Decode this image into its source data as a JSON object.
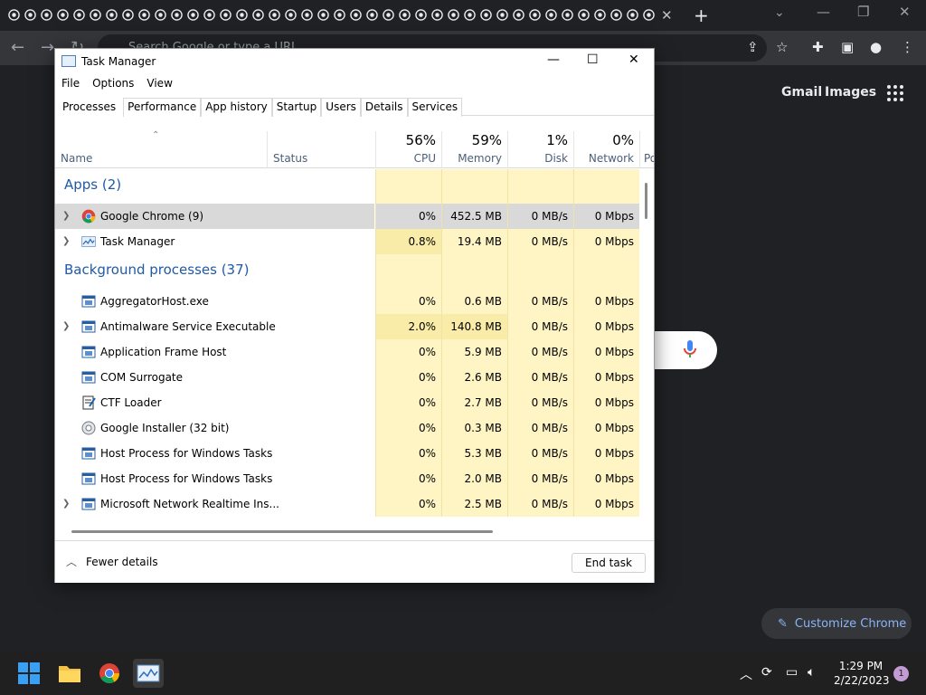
{
  "browser": {
    "omnibox_placeholder": "Search Google or type a URL",
    "tab_close": "✕",
    "new_tab": "+",
    "links": {
      "gmail": "Gmail",
      "images": "Images"
    },
    "customize": "Customize Chrome"
  },
  "taskmanager": {
    "title": "Task Manager",
    "menu": [
      "File",
      "Options",
      "View"
    ],
    "tabs": [
      "Processes",
      "Performance",
      "App history",
      "Startup",
      "Users",
      "Details",
      "Services"
    ],
    "columns": {
      "name": "Name",
      "status": "Status",
      "cpu": {
        "pct": "56%",
        "label": "CPU"
      },
      "memory": {
        "pct": "59%",
        "label": "Memory"
      },
      "disk": {
        "pct": "1%",
        "label": "Disk"
      },
      "network": {
        "pct": "0%",
        "label": "Network"
      },
      "power": "Po"
    },
    "apps_group": "Apps (2)",
    "bg_group": "Background processes (37)",
    "apps": [
      {
        "name": "Google Chrome (9)",
        "cpu": "0%",
        "mem": "452.5 MB",
        "disk": "0 MB/s",
        "net": "0 Mbps",
        "icon": "chrome-icon",
        "expand": true
      },
      {
        "name": "Task Manager",
        "cpu": "0.8%",
        "mem": "19.4 MB",
        "disk": "0 MB/s",
        "net": "0 Mbps",
        "icon": "task-manager-icon",
        "expand": true
      }
    ],
    "background": [
      {
        "name": "AggregatorHost.exe",
        "cpu": "0%",
        "mem": "0.6 MB",
        "disk": "0 MB/s",
        "net": "0 Mbps",
        "icon": "window-icon",
        "expand": false
      },
      {
        "name": "Antimalware Service Executable",
        "cpu": "2.0%",
        "mem": "140.8 MB",
        "disk": "0 MB/s",
        "net": "0 Mbps",
        "icon": "window-icon",
        "expand": true
      },
      {
        "name": "Application Frame Host",
        "cpu": "0%",
        "mem": "5.9 MB",
        "disk": "0 MB/s",
        "net": "0 Mbps",
        "icon": "window-icon",
        "expand": false
      },
      {
        "name": "COM Surrogate",
        "cpu": "0%",
        "mem": "2.6 MB",
        "disk": "0 MB/s",
        "net": "0 Mbps",
        "icon": "window-icon",
        "expand": false
      },
      {
        "name": "CTF Loader",
        "cpu": "0%",
        "mem": "2.7 MB",
        "disk": "0 MB/s",
        "net": "0 Mbps",
        "icon": "notepad-icon",
        "expand": false
      },
      {
        "name": "Google Installer (32 bit)",
        "cpu": "0%",
        "mem": "0.3 MB",
        "disk": "0 MB/s",
        "net": "0 Mbps",
        "icon": "installer-icon",
        "expand": false
      },
      {
        "name": "Host Process for Windows Tasks",
        "cpu": "0%",
        "mem": "5.3 MB",
        "disk": "0 MB/s",
        "net": "0 Mbps",
        "icon": "window-icon",
        "expand": false
      },
      {
        "name": "Host Process for Windows Tasks",
        "cpu": "0%",
        "mem": "2.0 MB",
        "disk": "0 MB/s",
        "net": "0 Mbps",
        "icon": "window-icon",
        "expand": false
      },
      {
        "name": "Microsoft Network Realtime Ins...",
        "cpu": "0%",
        "mem": "2.5 MB",
        "disk": "0 MB/s",
        "net": "0 Mbps",
        "icon": "window-icon",
        "expand": true
      }
    ],
    "fewer_details": "Fewer details",
    "end_task": "End task"
  },
  "taskbar": {
    "time": "1:29 PM",
    "date": "2/22/2023",
    "notifications": "1"
  }
}
